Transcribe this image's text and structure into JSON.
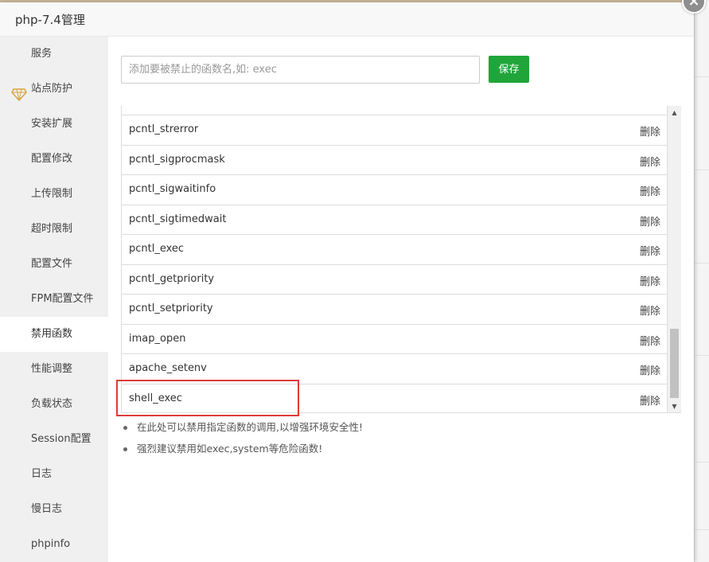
{
  "dialog": {
    "title": "php-7.4管理"
  },
  "sidebar": {
    "items": [
      {
        "label": "服务"
      },
      {
        "label": "站点防护"
      },
      {
        "label": "安装扩展"
      },
      {
        "label": "配置修改"
      },
      {
        "label": "上传限制"
      },
      {
        "label": "超时限制"
      },
      {
        "label": "配置文件"
      },
      {
        "label": "FPM配置文件"
      },
      {
        "label": "禁用函数"
      },
      {
        "label": "性能调整"
      },
      {
        "label": "负载状态"
      },
      {
        "label": "Session配置"
      },
      {
        "label": "日志"
      },
      {
        "label": "慢日志"
      },
      {
        "label": "phpinfo"
      }
    ],
    "active_label": "禁用函数"
  },
  "form": {
    "placeholder": "添加要被禁止的函数名,如: exec",
    "value": "",
    "save_label": "保存"
  },
  "table": {
    "rows": [
      {
        "name": "pcntl_strerror",
        "action": "删除"
      },
      {
        "name": "pcntl_sigprocmask",
        "action": "删除"
      },
      {
        "name": "pcntl_sigwaitinfo",
        "action": "删除"
      },
      {
        "name": "pcntl_sigtimedwait",
        "action": "删除"
      },
      {
        "name": "pcntl_exec",
        "action": "删除"
      },
      {
        "name": "pcntl_getpriority",
        "action": "删除"
      },
      {
        "name": "pcntl_setpriority",
        "action": "删除"
      },
      {
        "name": "imap_open",
        "action": "删除"
      },
      {
        "name": "apache_setenv",
        "action": "删除"
      },
      {
        "name": "shell_exec",
        "action": "删除"
      }
    ],
    "highlighted": "shell_exec"
  },
  "notes": [
    "在此处可以禁用指定函数的调用,以增强环境安全性!",
    "强烈建议禁用如exec,system等危险函数!"
  ],
  "colors": {
    "accent": "#20a53a",
    "highlight": "#e03a3a"
  }
}
